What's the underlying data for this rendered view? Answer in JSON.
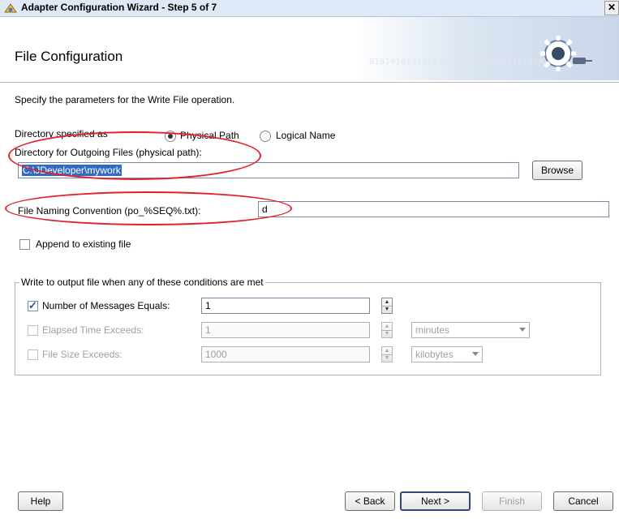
{
  "window": {
    "title": "Adapter Configuration Wizard - Step 5 of 7",
    "close_glyph": "✕"
  },
  "banner": {
    "heading": "File Configuration",
    "binary_text": "010101010101010101010101010101010101010"
  },
  "intro": "Specify the parameters for the Write File operation.",
  "directory": {
    "specified_as_label": "Directory specified as",
    "option_physical": "Physical Path",
    "option_logical": "Logical Name",
    "selected": "Physical Path",
    "outgoing_label": "Directory for Outgoing Files (physical path):",
    "outgoing_value": "C:\\JDeveloper\\mywork",
    "browse_label": "Browse"
  },
  "naming": {
    "label": "File Naming Convention (po_%SEQ%.txt):",
    "value": "d"
  },
  "append": {
    "label": "Append to existing file",
    "checked": false
  },
  "conditions": {
    "group_title": "Write to output file when any of these conditions are met",
    "messages": {
      "label": "Number of Messages Equals:",
      "checked": true,
      "value": "1"
    },
    "elapsed": {
      "label": "Elapsed Time Exceeds:",
      "checked": false,
      "value": "1",
      "unit": "minutes"
    },
    "size": {
      "label": "File Size Exceeds:",
      "checked": false,
      "value": "1000",
      "unit": "kilobytes"
    }
  },
  "footer": {
    "help": "Help",
    "back": "< Back",
    "next": "Next >",
    "finish": "Finish",
    "cancel": "Cancel"
  },
  "colors": {
    "annotation": "#e32028",
    "selection": "#316ac5",
    "check": "#2a53a0"
  },
  "icons": [
    "app-icon",
    "close-icon",
    "gear-plug-icon",
    "check-icon",
    "spinner-up-icon",
    "spinner-down-icon",
    "dropdown-arrow-icon"
  ]
}
